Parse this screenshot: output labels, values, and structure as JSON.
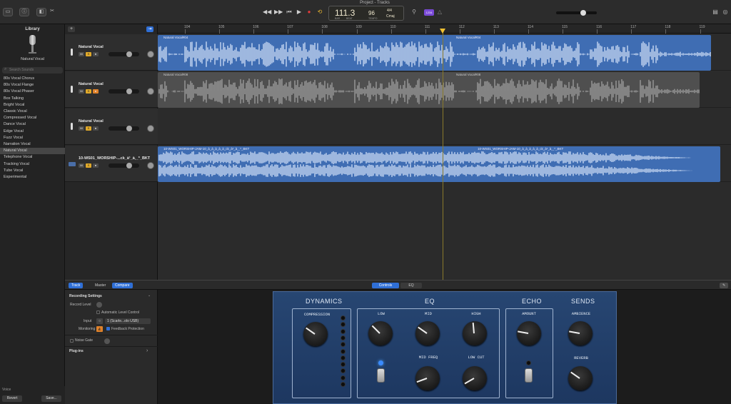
{
  "window": {
    "title": "Project - Tracks"
  },
  "transport": {
    "rewind": "◀◀",
    "forward": "▶▶",
    "to_start": "⏮",
    "play": "▶",
    "record": "●",
    "cycle": "⟲",
    "bar_beat": "111.3",
    "tempo": "96",
    "signature": "4/4",
    "key": "Cmaj",
    "lcd_sub1": "BAR",
    "lcd_sub2": "BEAT",
    "lcd_sub3": "TEMPO",
    "count_in_badge": "1234"
  },
  "library": {
    "title": "Library",
    "preset_name": "Natural Vocal",
    "search_placeholder": "Search Sounds",
    "items": [
      "80s Vocal Chorus",
      "80s Vocal Flange",
      "80s Vocal Phaser",
      "Box Talking",
      "Bright Vocal",
      "Classic Vocal",
      "Compressed Vocal",
      "Dance Vocal",
      "Edge Vocal",
      "Fuzz Vocal",
      "Narration Vocal",
      "Natural Vocal",
      "Telephone Vocal",
      "Tracking Vocal",
      "Tube Vocal",
      "Experimental"
    ],
    "selected_index": 11,
    "voice_label": "Voice",
    "revert": "Revert",
    "save": "Save..."
  },
  "ruler": {
    "bars": [
      "104",
      "105",
      "106",
      "107",
      "108",
      "109",
      "110",
      "111",
      "112",
      "113",
      "114",
      "115",
      "116",
      "117",
      "118",
      "119"
    ]
  },
  "tracks": [
    {
      "name": "Natural Vocal",
      "region_label": "Natural Vocal#04",
      "region_label2": "Natural Vocal#04",
      "color": "#3f6db3"
    },
    {
      "name": "Natural Vocal",
      "region_label": "Natural Vocal#08",
      "region_label2": "Natural Vocal#08",
      "color": "#5a5a5a"
    },
    {
      "name": "Natural Vocal",
      "region_label": "",
      "region_label2": "",
      "color": "#2b2b2b"
    },
    {
      "name": "10-WS01_WORSHIP-...ck_à¹_à¸_*_BKT",
      "region_label": "10-WS01_WORSHIP-JAM-10_à_à_à_à_à_ck_à¹_à¸_*_BKT",
      "region_label2": "10-WS01_WORSHIP-JAM-10_à_à_à_à_à_ck_à¹_à¸_*_BKT",
      "color": "#3f6db3"
    }
  ],
  "bottom_tabs": {
    "track": "Track",
    "master": "Master",
    "compare": "Compare",
    "controls": "Controls",
    "eq": "EQ"
  },
  "inspector": {
    "recording_settings": "Recording Settings",
    "record_level": "Record Level",
    "auto_level": "Automatic Level Control",
    "input_label": "Input",
    "input_value": "1 (Scarle...olo USB)",
    "monitoring_label": "Monitoring",
    "feedback_protection": "Feedback Protection",
    "noise_gate": "Noise Gate",
    "plugins": "Plug-ins"
  },
  "amp": {
    "dynamics": "DYNAMICS",
    "eq": "EQ",
    "echo": "ECHO",
    "sends": "SENDS",
    "compression": "COMPRESSION",
    "low": "LOW",
    "mid": "MID",
    "high": "HIGH",
    "mid_freq": "MID FREQ",
    "low_cut": "LOW CUT",
    "amount": "AMOUNT",
    "ambience": "AMBIENCE",
    "reverb": "REVERB"
  }
}
